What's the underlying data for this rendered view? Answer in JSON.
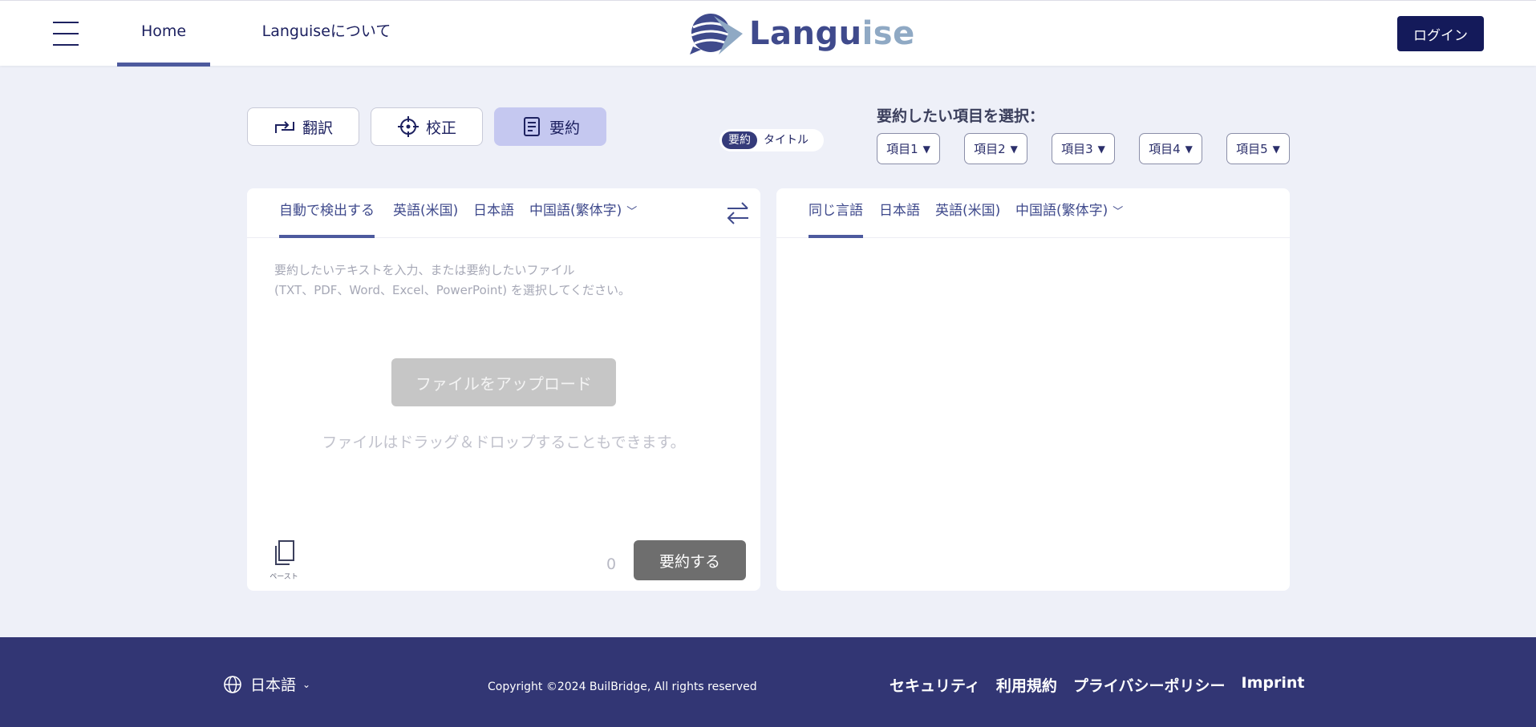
{
  "header": {
    "nav": {
      "home": "Home",
      "about": "Languiseについて"
    },
    "logo": {
      "part1": "Langu",
      "part2": "ise"
    },
    "login": "ログイン"
  },
  "modes": {
    "translate": "翻訳",
    "proofread": "校正",
    "summary": "要約"
  },
  "toggle": {
    "summary": "要約",
    "title": "タイトル"
  },
  "select_items": {
    "label": "要約したい項目を選択：",
    "items": [
      "項目1",
      "項目2",
      "項目3",
      "項目4",
      "項目5"
    ]
  },
  "source_panel": {
    "langs": [
      "自動で検出する",
      "英語(米国)",
      "日本語",
      "中国語(繁体字)"
    ],
    "placeholder_line1": "要約したいテキストを入力、または要約したいファイル",
    "placeholder_line2": "(TXT、PDF、Word、Excel、PowerPoint) を選択してください。",
    "upload": "ファイルをアップロード",
    "drop_hint": "ファイルはドラッグ＆ドロップすることもできます。",
    "paste": "ペースト",
    "char_count": "0",
    "submit": "要約する"
  },
  "target_panel": {
    "langs": [
      "同じ言語",
      "日本語",
      "英語(米国)",
      "中国語(繁体字)"
    ]
  },
  "footer": {
    "language": "日本語",
    "copyright": "Copyright ©2024 BuilBridge, All rights reserved",
    "links": [
      "セキュリティ",
      "利用規約",
      "プライバシーポリシー",
      "Imprint"
    ]
  },
  "colors": {
    "brand_navy": "#141a5a",
    "footer_bg": "#323674",
    "page_bg": "#eef0f8",
    "active_mode": "#c5c8f0",
    "accent": "#4d5a9e"
  }
}
